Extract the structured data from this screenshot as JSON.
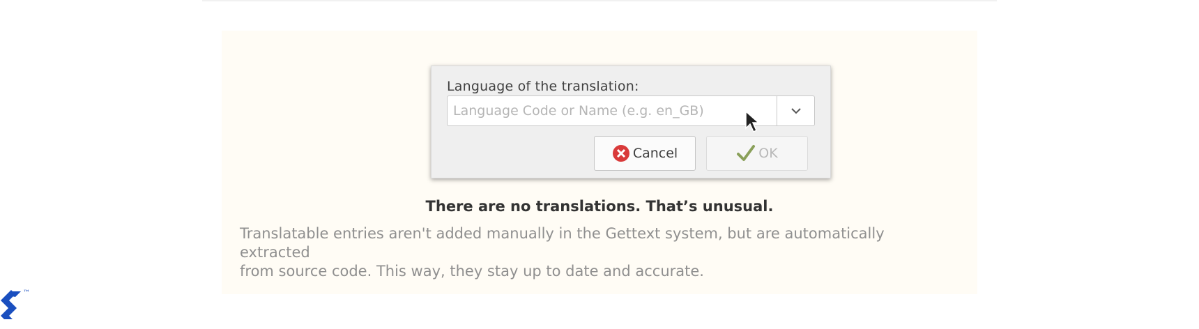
{
  "dialog": {
    "label": "Language of the translation:",
    "language_input": {
      "value": "",
      "placeholder": "Language Code or Name (e.g. en_GB)"
    },
    "cancel_label": "Cancel",
    "ok_label": "OK"
  },
  "empty_state": {
    "title": "There are no translations. That’s unusual.",
    "description_lines": [
      "Translatable entries aren't added manually in the Gettext system, but are automatically",
      "extracted",
      "from source code. This way, they stay up to date and accurate."
    ]
  },
  "brand": {
    "logo_icon": "toptal-logo-icon",
    "trademark": "™",
    "color": "#1a4fbf"
  },
  "colors": {
    "panel_background": "#fffcf5",
    "dialog_background": "#efefef",
    "cancel_icon": "#d93a3a",
    "ok_check": "#6d8a3a"
  }
}
